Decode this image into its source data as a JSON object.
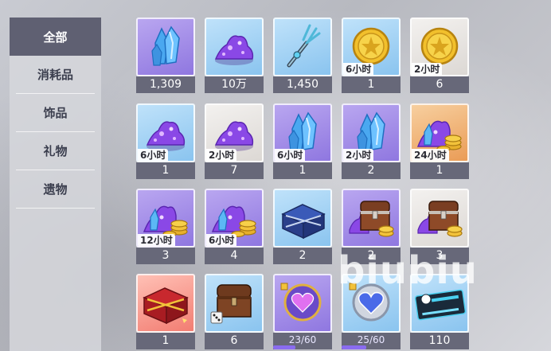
{
  "sidebar": {
    "items": [
      {
        "label": "全部",
        "active": true
      },
      {
        "label": "消耗品",
        "active": false
      },
      {
        "label": "饰品",
        "active": false
      },
      {
        "label": "礼物",
        "active": false
      },
      {
        "label": "遗物",
        "active": false
      }
    ]
  },
  "items": [
    {
      "name": "blue-crystal-item",
      "icon": "blue-crystal-icon",
      "rarity": "purple",
      "timer": "",
      "count": "1,309"
    },
    {
      "name": "purple-crystal-pile-item",
      "icon": "purple-crystal-pile-icon",
      "rarity": "blue",
      "timer": "",
      "count": "10万"
    },
    {
      "name": "trident-key-item",
      "icon": "trident-key-icon",
      "rarity": "blue",
      "timer": "",
      "count": "1,450"
    },
    {
      "name": "gold-coin-item",
      "icon": "gold-coin-icon",
      "rarity": "blue",
      "timer": "6小时",
      "count": "1"
    },
    {
      "name": "gold-coin-item",
      "icon": "gold-coin-icon",
      "rarity": "white",
      "timer": "2小时",
      "count": "6"
    },
    {
      "name": "purple-crystal-pile-item",
      "icon": "purple-crystal-pile-icon",
      "rarity": "blue",
      "timer": "6小时",
      "count": "1"
    },
    {
      "name": "purple-crystal-pile-item",
      "icon": "purple-crystal-pile-icon",
      "rarity": "white",
      "timer": "2小时",
      "count": "7"
    },
    {
      "name": "blue-crystal-item",
      "icon": "blue-crystal-icon",
      "rarity": "purple",
      "timer": "6小时",
      "count": "1"
    },
    {
      "name": "blue-crystal-item",
      "icon": "blue-crystal-icon",
      "rarity": "purple",
      "timer": "2小时",
      "count": "2"
    },
    {
      "name": "crystal-coin-bundle-item",
      "icon": "crystal-coin-bundle-icon",
      "rarity": "orange",
      "timer": "24小时",
      "count": "1"
    },
    {
      "name": "crystal-coin-bundle-item",
      "icon": "crystal-coin-bundle-icon",
      "rarity": "purple",
      "timer": "12小时",
      "count": "3"
    },
    {
      "name": "crystal-coin-bundle-item",
      "icon": "crystal-coin-bundle-icon",
      "rarity": "purple",
      "timer": "6小时",
      "count": "4"
    },
    {
      "name": "blue-chest-item",
      "icon": "blue-chest-icon",
      "rarity": "blue",
      "timer": "",
      "count": "2"
    },
    {
      "name": "treasure-chest-item",
      "icon": "treasure-chest-icon",
      "rarity": "purple",
      "timer": "",
      "count": "2"
    },
    {
      "name": "treasure-chest-item",
      "icon": "treasure-chest-icon",
      "rarity": "white",
      "timer": "",
      "count": "3"
    },
    {
      "name": "red-gold-chest-item",
      "icon": "red-gold-chest-icon",
      "rarity": "red",
      "timer": "",
      "count": "1"
    },
    {
      "name": "wooden-chest-dice-item",
      "icon": "wooden-chest-dice-icon",
      "rarity": "blue",
      "timer": "",
      "count": "6"
    },
    {
      "name": "heart-orb-item",
      "icon": "heart-orb-icon",
      "rarity": "purple",
      "timer": "",
      "count": "",
      "progress": "23/60",
      "progress_value": 0.383
    },
    {
      "name": "heart-gem-puzzle-item",
      "icon": "heart-gem-puzzle-icon",
      "rarity": "blue",
      "timer": "",
      "count": "",
      "progress": "25/60",
      "progress_value": 0.417
    },
    {
      "name": "ticket-item",
      "icon": "ticket-icon",
      "rarity": "blue",
      "timer": "",
      "count": "110"
    }
  ],
  "watermark": "biubiu",
  "colors": {
    "sidebar_active": "#5f6072",
    "count_bar": "#676879",
    "rarity_purple": "#9b85e8",
    "rarity_blue": "#a5d3f5",
    "rarity_white": "#e8e5e2",
    "rarity_orange": "#f0b070",
    "rarity_red": "#f59c92"
  }
}
